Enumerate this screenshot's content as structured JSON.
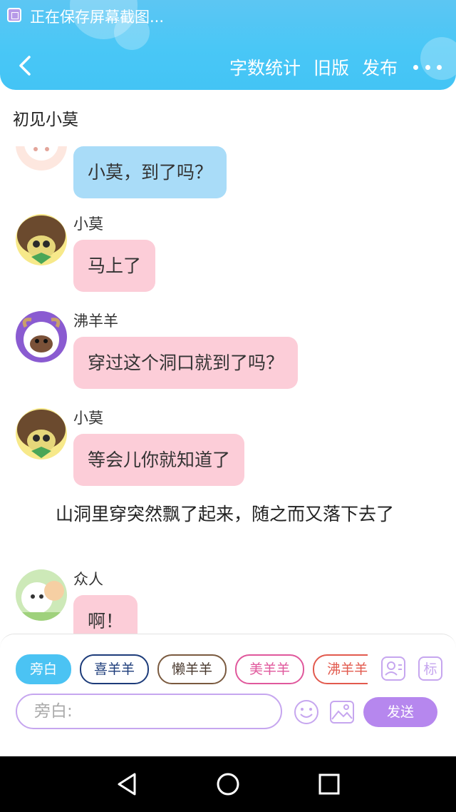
{
  "status_bar": {
    "text": "正在保存屏幕截图..."
  },
  "header": {
    "actions": [
      "字数统计",
      "旧版",
      "发布"
    ],
    "accent": "#49c7f6"
  },
  "chapter": {
    "title": "初见小莫"
  },
  "messages": [
    {
      "speaker": "",
      "text": "小莫，到了吗？",
      "bubble": "blue"
    },
    {
      "speaker": "小莫",
      "text": "马上了",
      "bubble": "pink"
    },
    {
      "speaker": "沸羊羊",
      "text": "穿过这个洞口就到了吗？",
      "bubble": "pink"
    },
    {
      "speaker": "小莫",
      "text": "等会儿你就知道了",
      "bubble": "pink"
    },
    {
      "narration": "山洞里穿突然飘了起来，随之而又落下去了"
    },
    {
      "speaker": "众人",
      "text": "啊！",
      "bubble": "pink"
    }
  ],
  "composer": {
    "role_chips": [
      "旁白",
      "喜羊羊",
      "懒羊羊",
      "美羊羊",
      "沸羊羊"
    ],
    "active_chip": "旁白",
    "extra_icons": [
      "contact-card-icon",
      "tag-icon"
    ],
    "tag_icon_text": "标",
    "input_placeholder": "旁白:",
    "send_label": "发送",
    "send_color": "#b687ee"
  },
  "nav": {
    "buttons": [
      "back-triangle-icon",
      "home-circle-icon",
      "recents-square-icon"
    ]
  }
}
